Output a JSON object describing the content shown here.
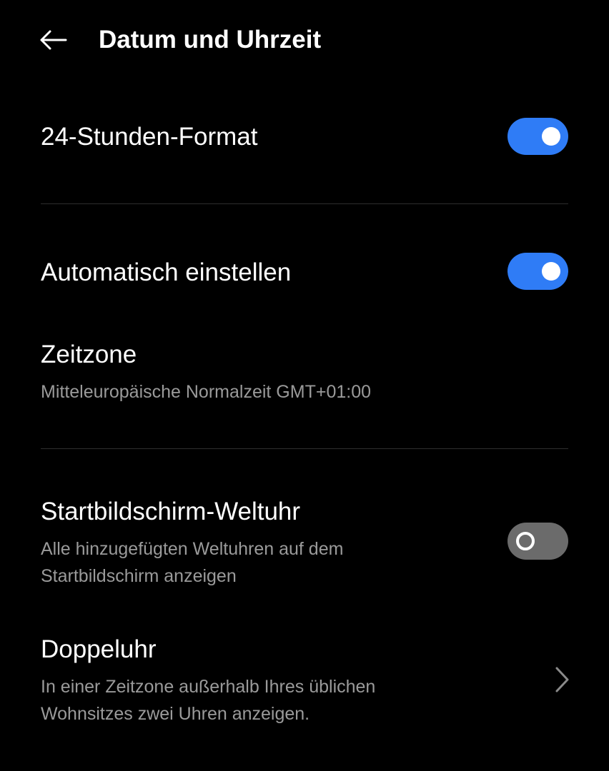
{
  "header": {
    "title": "Datum und Uhrzeit",
    "back_icon": "arrow-left-icon"
  },
  "colors": {
    "background": "#000000",
    "toggle_on": "#2f7cf6",
    "toggle_off": "#6b6b6b",
    "secondary_text": "#9a9a9a"
  },
  "settings": {
    "format24": {
      "label": "24-Stunden-Format",
      "enabled": true
    },
    "auto_set": {
      "label": "Automatisch einstellen",
      "enabled": true
    },
    "timezone": {
      "label": "Zeitzone",
      "value": "Mitteleuropäische Normalzeit GMT+01:00"
    },
    "world_clock": {
      "label": "Startbildschirm-Weltuhr",
      "description": "Alle hinzugefügten Weltuhren auf dem Startbildschirm anzeigen",
      "enabled": false
    },
    "dual_clock": {
      "label": "Doppeluhr",
      "description": "In einer Zeitzone außerhalb Ihres üblichen Wohnsitzes zwei Uhren anzeigen.",
      "icon": "chevron-right-icon"
    }
  }
}
